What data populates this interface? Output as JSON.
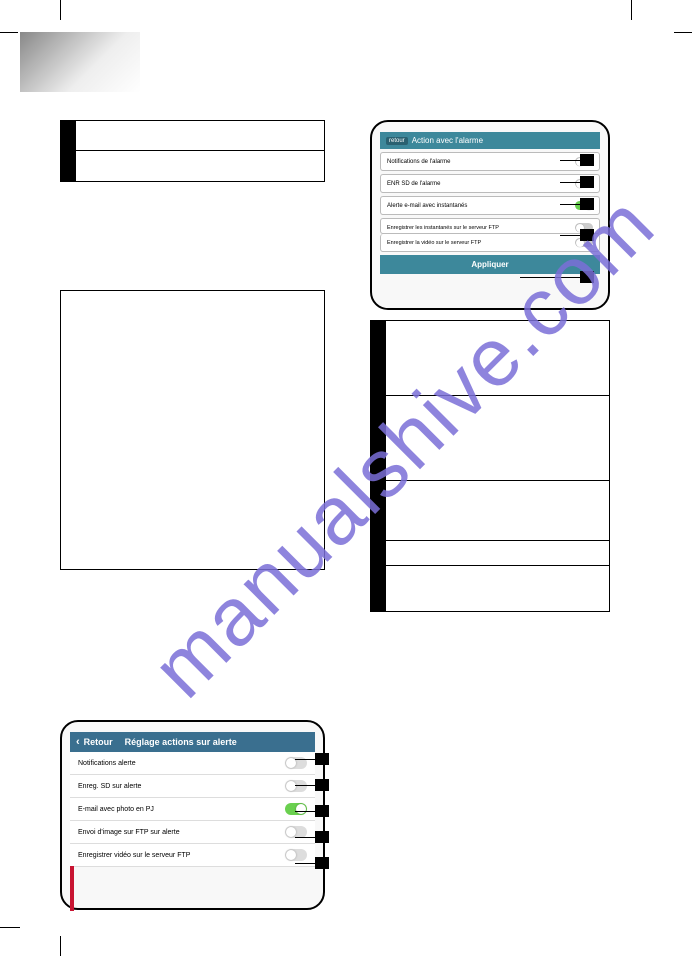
{
  "watermark": "manualshive.com",
  "table_tl": {
    "row1": "",
    "row2": ""
  },
  "textblock": "",
  "ios_phone": {
    "back": "Retour",
    "title": "Réglage actions sur alerte",
    "rows": [
      "Notifications alerte",
      "Enreg. SD sur alerte",
      "E-mail avec photo en PJ",
      "Envoi d'image sur FTP sur alerte",
      "Enregistrer vidéo sur le serveur FTP"
    ]
  },
  "android_phone": {
    "back": "retour",
    "title": "Action avec l'alarme",
    "rows": [
      "Notifications de l'alarme",
      "ENR SD de l'alarme",
      "Alerte e-mail avec instantanés",
      "Enregistrer les instantanés sur le serveur FTP",
      "Enregistrer la vidéo sur le serveur FTP"
    ],
    "apply": "Appliquer"
  },
  "table_rt": {
    "r1": "",
    "r2": "",
    "r3": "",
    "r4": "",
    "r5": ""
  }
}
